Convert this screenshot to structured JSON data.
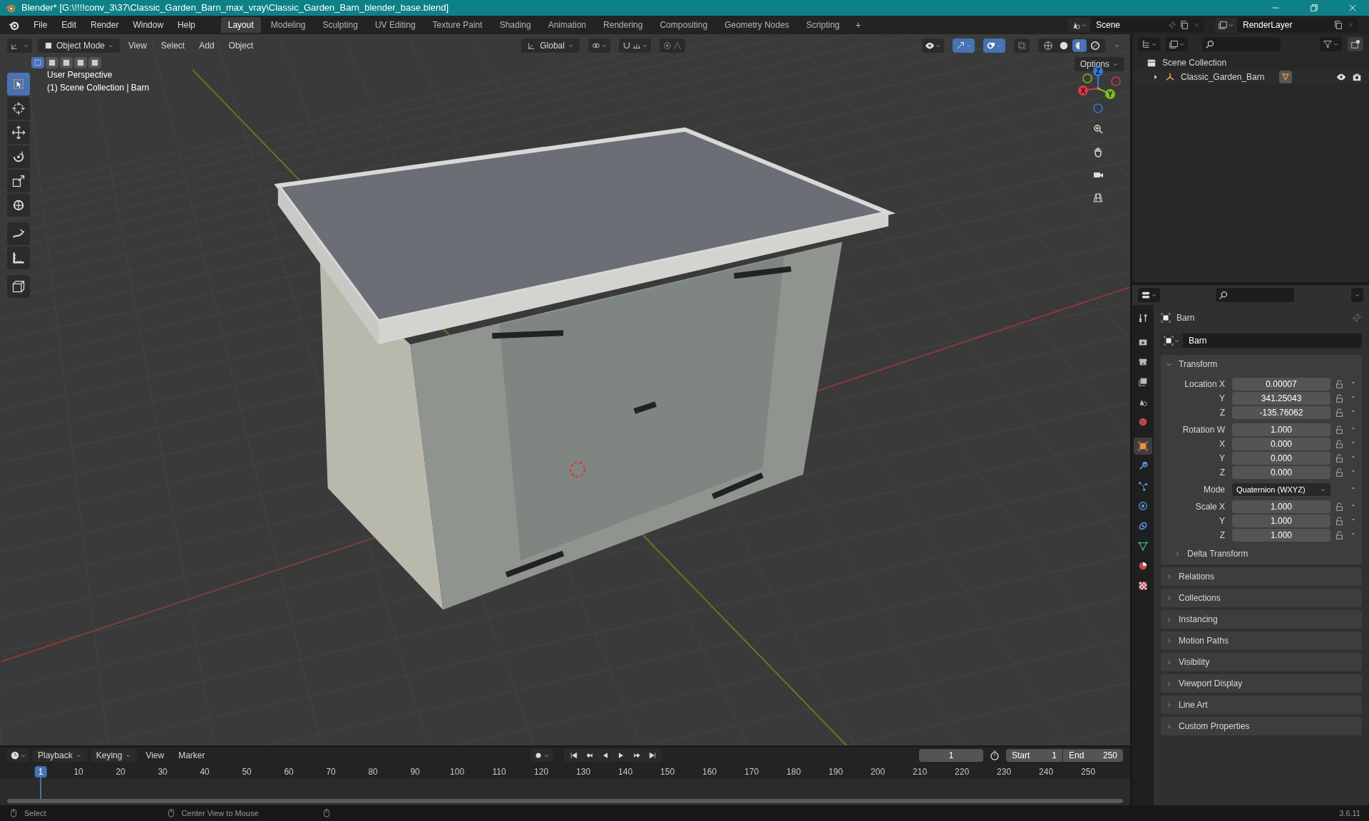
{
  "window": {
    "title": "Blender* [G:\\!!!!conv_3\\37\\Classic_Garden_Barn_max_vray\\Classic_Garden_Barn_blender_base.blend]"
  },
  "menu": [
    "File",
    "Edit",
    "Render",
    "Window",
    "Help"
  ],
  "workspaces": [
    {
      "label": "Layout",
      "selected": true
    },
    {
      "label": "Modeling",
      "selected": false
    },
    {
      "label": "Sculpting",
      "selected": false
    },
    {
      "label": "UV Editing",
      "selected": false
    },
    {
      "label": "Texture Paint",
      "selected": false
    },
    {
      "label": "Shading",
      "selected": false
    },
    {
      "label": "Animation",
      "selected": false
    },
    {
      "label": "Rendering",
      "selected": false
    },
    {
      "label": "Compositing",
      "selected": false
    },
    {
      "label": "Geometry Nodes",
      "selected": false
    },
    {
      "label": "Scripting",
      "selected": false
    }
  ],
  "add_workspace": "+",
  "gizmo_toggle": {
    "on": true
  },
  "overlay_toggle": {
    "on": true
  },
  "scene": {
    "name": "Scene"
  },
  "view_layer": {
    "name": "RenderLayer"
  },
  "viewport": {
    "mode": "Object Mode",
    "menus": [
      "View",
      "Select",
      "Add",
      "Object"
    ],
    "orientation": "Global",
    "options": "Options",
    "overlay_lines": [
      "User Perspective",
      "(1) Scene Collection | Barn"
    ],
    "select_modes": [
      {
        "selected": true
      },
      {
        "selected": false
      },
      {
        "selected": false
      },
      {
        "selected": false
      },
      {
        "selected": false
      }
    ],
    "tools": [
      {
        "kind": "select",
        "selected": true
      },
      {
        "kind": "cursor",
        "selected": false
      },
      {
        "kind": "move",
        "selected": false
      },
      {
        "kind": "rotate",
        "selected": false
      },
      {
        "kind": "scale",
        "selected": false
      },
      {
        "kind": "transform",
        "selected": false
      },
      {
        "kind": "annotate",
        "selected": false
      },
      {
        "kind": "measure",
        "selected": false
      },
      {
        "kind": "add_cube",
        "selected": false
      }
    ],
    "shading": [
      {
        "kind": "wireframe",
        "selected": false
      },
      {
        "kind": "solid",
        "selected": false
      },
      {
        "kind": "material",
        "selected": true
      },
      {
        "kind": "rendered",
        "selected": false
      }
    ],
    "gizmo": [
      {
        "label": "Z",
        "color": "#2f7be0"
      },
      {
        "label": "X",
        "color": "#e0374b"
      },
      {
        "label": "Y",
        "color": "#7dbd21"
      }
    ]
  },
  "outliner": {
    "root": "Scene Collection",
    "items": [
      {
        "label": "Classic_Garden_Barn",
        "expanded": false,
        "visible": true
      }
    ]
  },
  "properties": {
    "tabs": [
      {
        "kind": "tool",
        "selected": false
      },
      {
        "kind": "render",
        "selected": false
      },
      {
        "kind": "output",
        "selected": false
      },
      {
        "kind": "view_layer",
        "selected": false
      },
      {
        "kind": "scene",
        "selected": false
      },
      {
        "kind": "world",
        "selected": false
      },
      {
        "kind": "object",
        "selected": true
      },
      {
        "kind": "modifier",
        "selected": false
      },
      {
        "kind": "particles",
        "selected": false
      },
      {
        "kind": "physics",
        "selected": false
      },
      {
        "kind": "constraints",
        "selected": false
      },
      {
        "kind": "data",
        "selected": false
      },
      {
        "kind": "material",
        "selected": false
      },
      {
        "kind": "texture",
        "selected": false
      }
    ],
    "object_name": "Barn",
    "data_name": "Barn",
    "transform": {
      "label": "Transform",
      "expanded": true,
      "groups": [
        {
          "rows": [
            {
              "kind": "number",
              "label": "Location X",
              "value": "0.00007"
            },
            {
              "kind": "number",
              "label": "Y",
              "value": "341.25043"
            },
            {
              "kind": "number",
              "label": "Z",
              "value": "-135.76062"
            }
          ]
        },
        {
          "rows": [
            {
              "kind": "number",
              "label": "Rotation W",
              "value": "1.000"
            },
            {
              "kind": "number",
              "label": "X",
              "value": "0.000"
            },
            {
              "kind": "number",
              "label": "Y",
              "value": "0.000"
            },
            {
              "kind": "number",
              "label": "Z",
              "value": "0.000"
            }
          ]
        },
        {
          "rows": [
            {
              "kind": "dropdown",
              "label": "Mode",
              "value": "Quaternion (WXYZ)"
            }
          ]
        },
        {
          "rows": [
            {
              "kind": "number",
              "label": "Scale X",
              "value": "1.000"
            },
            {
              "kind": "number",
              "label": "Y",
              "value": "1.000"
            },
            {
              "kind": "number",
              "label": "Z",
              "value": "1.000"
            }
          ]
        }
      ],
      "subpanel": {
        "label": "Delta Transform",
        "expanded": false
      }
    },
    "panels": [
      {
        "label": "Relations",
        "expanded": false
      },
      {
        "label": "Collections",
        "expanded": false
      },
      {
        "label": "Instancing",
        "expanded": false
      },
      {
        "label": "Motion Paths",
        "expanded": false
      },
      {
        "label": "Visibility",
        "expanded": false
      },
      {
        "label": "Viewport Display",
        "expanded": false
      },
      {
        "label": "Line Art",
        "expanded": false
      },
      {
        "label": "Custom Properties",
        "expanded": false
      }
    ]
  },
  "timeline": {
    "menus": [
      "Playback",
      "Keying",
      "View",
      "Marker"
    ],
    "current_frame": "1",
    "start_label": "Start",
    "start": "1",
    "end_label": "End",
    "end": "250",
    "ruler": [
      {
        "label": "1",
        "selected": true
      },
      {
        "label": "10",
        "selected": false
      },
      {
        "label": "20",
        "selected": false
      },
      {
        "label": "30",
        "selected": false
      },
      {
        "label": "40",
        "selected": false
      },
      {
        "label": "50",
        "selected": false
      },
      {
        "label": "60",
        "selected": false
      },
      {
        "label": "70",
        "selected": false
      },
      {
        "label": "80",
        "selected": false
      },
      {
        "label": "90",
        "selected": false
      },
      {
        "label": "100",
        "selected": false
      },
      {
        "label": "110",
        "selected": false
      },
      {
        "label": "120",
        "selected": false
      },
      {
        "label": "130",
        "selected": false
      },
      {
        "label": "140",
        "selected": false
      },
      {
        "label": "150",
        "selected": false
      },
      {
        "label": "160",
        "selected": false
      },
      {
        "label": "170",
        "selected": false
      },
      {
        "label": "180",
        "selected": false
      },
      {
        "label": "190",
        "selected": false
      },
      {
        "label": "200",
        "selected": false
      },
      {
        "label": "210",
        "selected": false
      },
      {
        "label": "220",
        "selected": false
      },
      {
        "label": "230",
        "selected": false
      },
      {
        "label": "240",
        "selected": false
      },
      {
        "label": "250",
        "selected": false
      }
    ]
  },
  "status_bar": {
    "items": [
      "Select",
      "Center View to Mouse"
    ],
    "version": "3.6.11"
  }
}
